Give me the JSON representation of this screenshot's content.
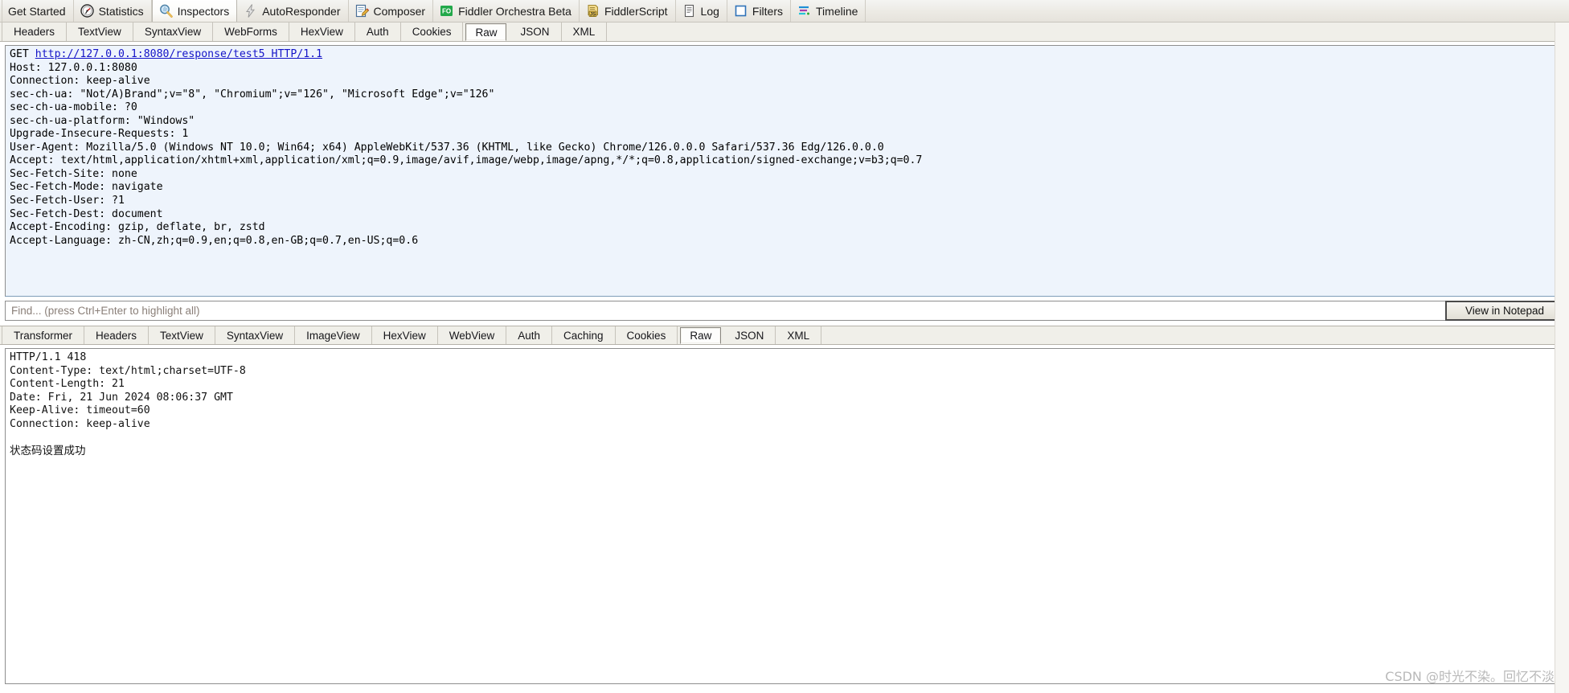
{
  "toolbar": {
    "items": [
      {
        "label": "Get Started",
        "icon": "none",
        "active": false
      },
      {
        "label": "Statistics",
        "icon": "statistics-icon",
        "active": false
      },
      {
        "label": "Inspectors",
        "icon": "inspectors-icon",
        "active": true
      },
      {
        "label": "AutoResponder",
        "icon": "autoresponder-icon",
        "active": false
      },
      {
        "label": "Composer",
        "icon": "composer-icon",
        "active": false
      },
      {
        "label": "Fiddler Orchestra Beta",
        "icon": "orchestra-icon",
        "active": false
      },
      {
        "label": "FiddlerScript",
        "icon": "fiddlerscript-icon",
        "active": false
      },
      {
        "label": "Log",
        "icon": "log-icon",
        "active": false
      },
      {
        "label": "Filters",
        "icon": "filters-icon",
        "active": false
      },
      {
        "label": "Timeline",
        "icon": "timeline-icon",
        "active": false
      }
    ]
  },
  "request": {
    "tabs": [
      {
        "label": "Headers",
        "selected": false
      },
      {
        "label": "TextView",
        "selected": false
      },
      {
        "label": "SyntaxView",
        "selected": false
      },
      {
        "label": "WebForms",
        "selected": false
      },
      {
        "label": "HexView",
        "selected": false
      },
      {
        "label": "Auth",
        "selected": false
      },
      {
        "label": "Cookies",
        "selected": false
      },
      {
        "label": "Raw",
        "selected": true
      },
      {
        "label": "JSON",
        "selected": false
      },
      {
        "label": "XML",
        "selected": false
      }
    ],
    "request_line_method": "GET ",
    "request_line_url": "http://127.0.0.1:8080/response/test5 HTTP/1.1",
    "headers_text": "Host: 127.0.0.1:8080\nConnection: keep-alive\nsec-ch-ua: \"Not/A)Brand\";v=\"8\", \"Chromium\";v=\"126\", \"Microsoft Edge\";v=\"126\"\nsec-ch-ua-mobile: ?0\nsec-ch-ua-platform: \"Windows\"\nUpgrade-Insecure-Requests: 1\nUser-Agent: Mozilla/5.0 (Windows NT 10.0; Win64; x64) AppleWebKit/537.36 (KHTML, like Gecko) Chrome/126.0.0.0 Safari/537.36 Edg/126.0.0.0\nAccept: text/html,application/xhtml+xml,application/xml;q=0.9,image/avif,image/webp,image/apng,*/*;q=0.8,application/signed-exchange;v=b3;q=0.7\nSec-Fetch-Site: none\nSec-Fetch-Mode: navigate\nSec-Fetch-User: ?1\nSec-Fetch-Dest: document\nAccept-Encoding: gzip, deflate, br, zstd\nAccept-Language: zh-CN,zh;q=0.9,en;q=0.8,en-GB;q=0.7,en-US;q=0.6"
  },
  "find": {
    "placeholder": "Find... (press Ctrl+Enter to highlight all)",
    "value": "",
    "notepad_button": "View in Notepad"
  },
  "response": {
    "tabs": [
      {
        "label": "Transformer",
        "selected": false
      },
      {
        "label": "Headers",
        "selected": false
      },
      {
        "label": "TextView",
        "selected": false
      },
      {
        "label": "SyntaxView",
        "selected": false
      },
      {
        "label": "ImageView",
        "selected": false
      },
      {
        "label": "HexView",
        "selected": false
      },
      {
        "label": "WebView",
        "selected": false
      },
      {
        "label": "Auth",
        "selected": false
      },
      {
        "label": "Caching",
        "selected": false
      },
      {
        "label": "Cookies",
        "selected": false
      },
      {
        "label": "Raw",
        "selected": true
      },
      {
        "label": "JSON",
        "selected": false
      },
      {
        "label": "XML",
        "selected": false
      }
    ],
    "headers_text": "HTTP/1.1 418\nContent-Type: text/html;charset=UTF-8\nContent-Length: 21\nDate: Fri, 21 Jun 2024 08:06:37 GMT\nKeep-Alive: timeout=60\nConnection: keep-alive",
    "body_text": "状态码设置成功"
  },
  "watermark": "CSDN @时光不染。回忆不淡",
  "colors": {
    "request_bg": "#eef4fc",
    "response_bg": "#ffffff",
    "link": "#1414c8",
    "toolbar_bg": "#ecebe5"
  }
}
